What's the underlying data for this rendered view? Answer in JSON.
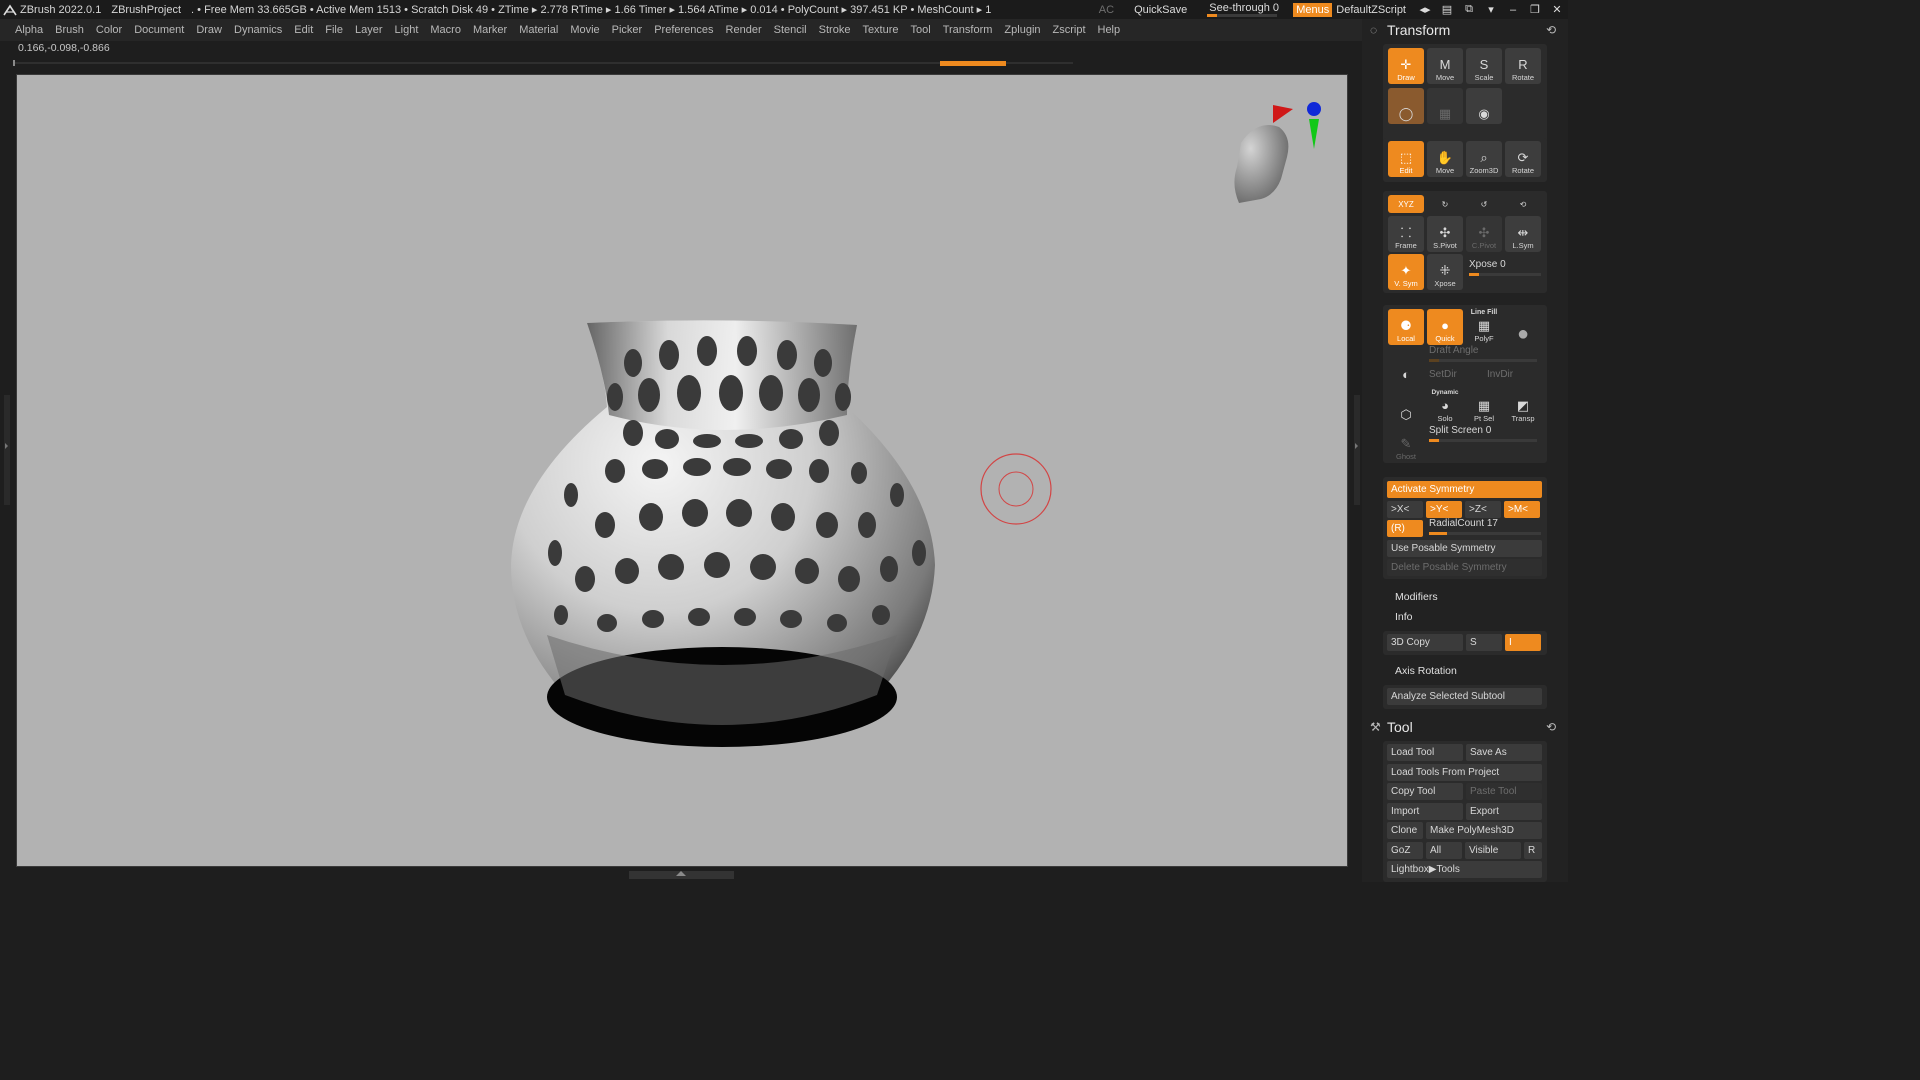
{
  "titlebar": {
    "app": "ZBrush 2022.0.1",
    "project": "ZBrushProject",
    "stats": ". • Free Mem 33.665GB • Active Mem 1513 • Scratch Disk 49 • ZTime ▸ 2.778 RTime ▸ 1.66 Timer ▸ 1.564 ATime ▸ 0.014 • PolyCount ▸ 397.451 KP • MeshCount ▸ 1",
    "ac": "AC",
    "quicksave": "QuickSave",
    "see_through": "See-through  0",
    "menus": "Menus",
    "script": "DefaultZScript"
  },
  "menubar": [
    "Alpha",
    "Brush",
    "Color",
    "Document",
    "Draw",
    "Dynamics",
    "Edit",
    "File",
    "Layer",
    "Light",
    "Macro",
    "Marker",
    "Material",
    "Movie",
    "Picker",
    "Preferences",
    "Render",
    "Stencil",
    "Stroke",
    "Texture",
    "Tool",
    "Transform",
    "Zplugin",
    "Zscript",
    "Help"
  ],
  "coords": "0.166,-0.098,-0.866",
  "transform": {
    "title": "Transform",
    "draw": "Draw",
    "move": "Move",
    "scale": "Scale",
    "rotate": "Rotate",
    "edit": "Edit",
    "move2": "Move",
    "zoom3d": "Zoom3D",
    "rotate2": "Rotate",
    "xyz": "XYZ",
    "frame": "Frame",
    "spivot": "S.Pivot",
    "cpivot": "C.Pivot",
    "lsym": "L.Sym",
    "vsym": "V. Sym",
    "xpose": "Xpose",
    "xpose_slider": "Xpose 0",
    "local": "Local",
    "quick": "Quick",
    "linefill": "Line Fill",
    "polyf": "PolyF",
    "draft_angle": "Draft Angle",
    "setdir": "SetDir",
    "invdir": "InvDir",
    "dynamic": "Dynamic",
    "solo": "Solo",
    "ptsel": "Pt Sel",
    "transp": "Transp",
    "ghost": "Ghost",
    "split_screen": "Split Screen 0",
    "activate_symmetry": "Activate Symmetry",
    "sx": ">X<",
    "sy": ">Y<",
    "sz": ">Z<",
    "sm": ">M<",
    "r": "(R)",
    "radial_count": "RadialCount 17",
    "use_posable": "Use Posable Symmetry",
    "delete_posable": "Delete Posable Symmetry",
    "modifiers": "Modifiers",
    "info": "Info",
    "copy3d": "3D Copy",
    "s": "S",
    "i": "I",
    "axis_rotation": "Axis Rotation",
    "analyze": "Analyze Selected Subtool"
  },
  "tool": {
    "title": "Tool",
    "load_tool": "Load Tool",
    "save_as": "Save As",
    "load_from_project": "Load Tools From Project",
    "copy_tool": "Copy Tool",
    "paste_tool": "Paste Tool",
    "import": "Import",
    "export": "Export",
    "clone": "Clone",
    "make_polymesh": "Make PolyMesh3D",
    "goz": "GoZ",
    "all": "All",
    "visible": "Visible",
    "r": "R",
    "lightbox_tools": "Lightbox▶Tools"
  },
  "levels": {
    "see_through": 0,
    "xpose": 0,
    "split_screen": 0,
    "radial_count": 17
  },
  "colors": {
    "accent": "#ee8a1f",
    "canvas_bg": "#b2b2b2",
    "ui_bg": "#1e1e1e"
  }
}
